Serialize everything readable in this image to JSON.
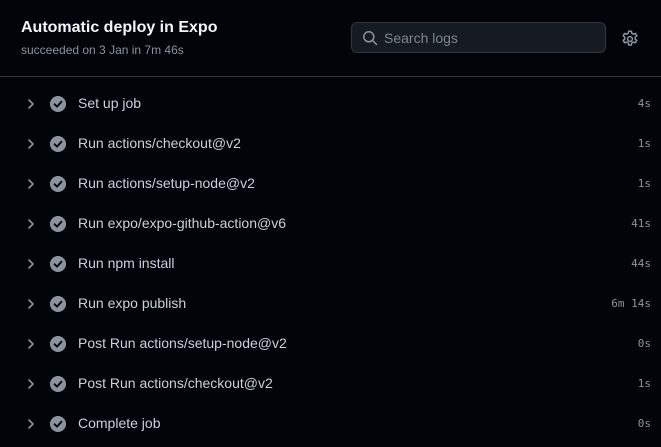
{
  "header": {
    "title": "Automatic deploy in Expo",
    "subtitle": "succeeded on 3 Jan in 7m 46s"
  },
  "search": {
    "placeholder": "Search logs"
  },
  "colors": {
    "background": "#010409",
    "check_icon": "#8b949e",
    "text": "#c9d1d9",
    "muted": "#8b949e"
  },
  "steps": [
    {
      "name": "Set up job",
      "duration": "4s",
      "icon": "check-circle-icon"
    },
    {
      "name": "Run actions/checkout@v2",
      "duration": "1s",
      "icon": "check-circle-icon"
    },
    {
      "name": "Run actions/setup-node@v2",
      "duration": "1s",
      "icon": "check-circle-icon"
    },
    {
      "name": "Run expo/expo-github-action@v6",
      "duration": "41s",
      "icon": "check-circle-icon"
    },
    {
      "name": "Run npm install",
      "duration": "44s",
      "icon": "check-circle-icon"
    },
    {
      "name": "Run expo publish",
      "duration": "6m 14s",
      "icon": "check-circle-icon"
    },
    {
      "name": "Post Run actions/setup-node@v2",
      "duration": "0s",
      "icon": "check-circle-icon"
    },
    {
      "name": "Post Run actions/checkout@v2",
      "duration": "1s",
      "icon": "check-circle-icon"
    },
    {
      "name": "Complete job",
      "duration": "0s",
      "icon": "check-circle-icon"
    }
  ]
}
